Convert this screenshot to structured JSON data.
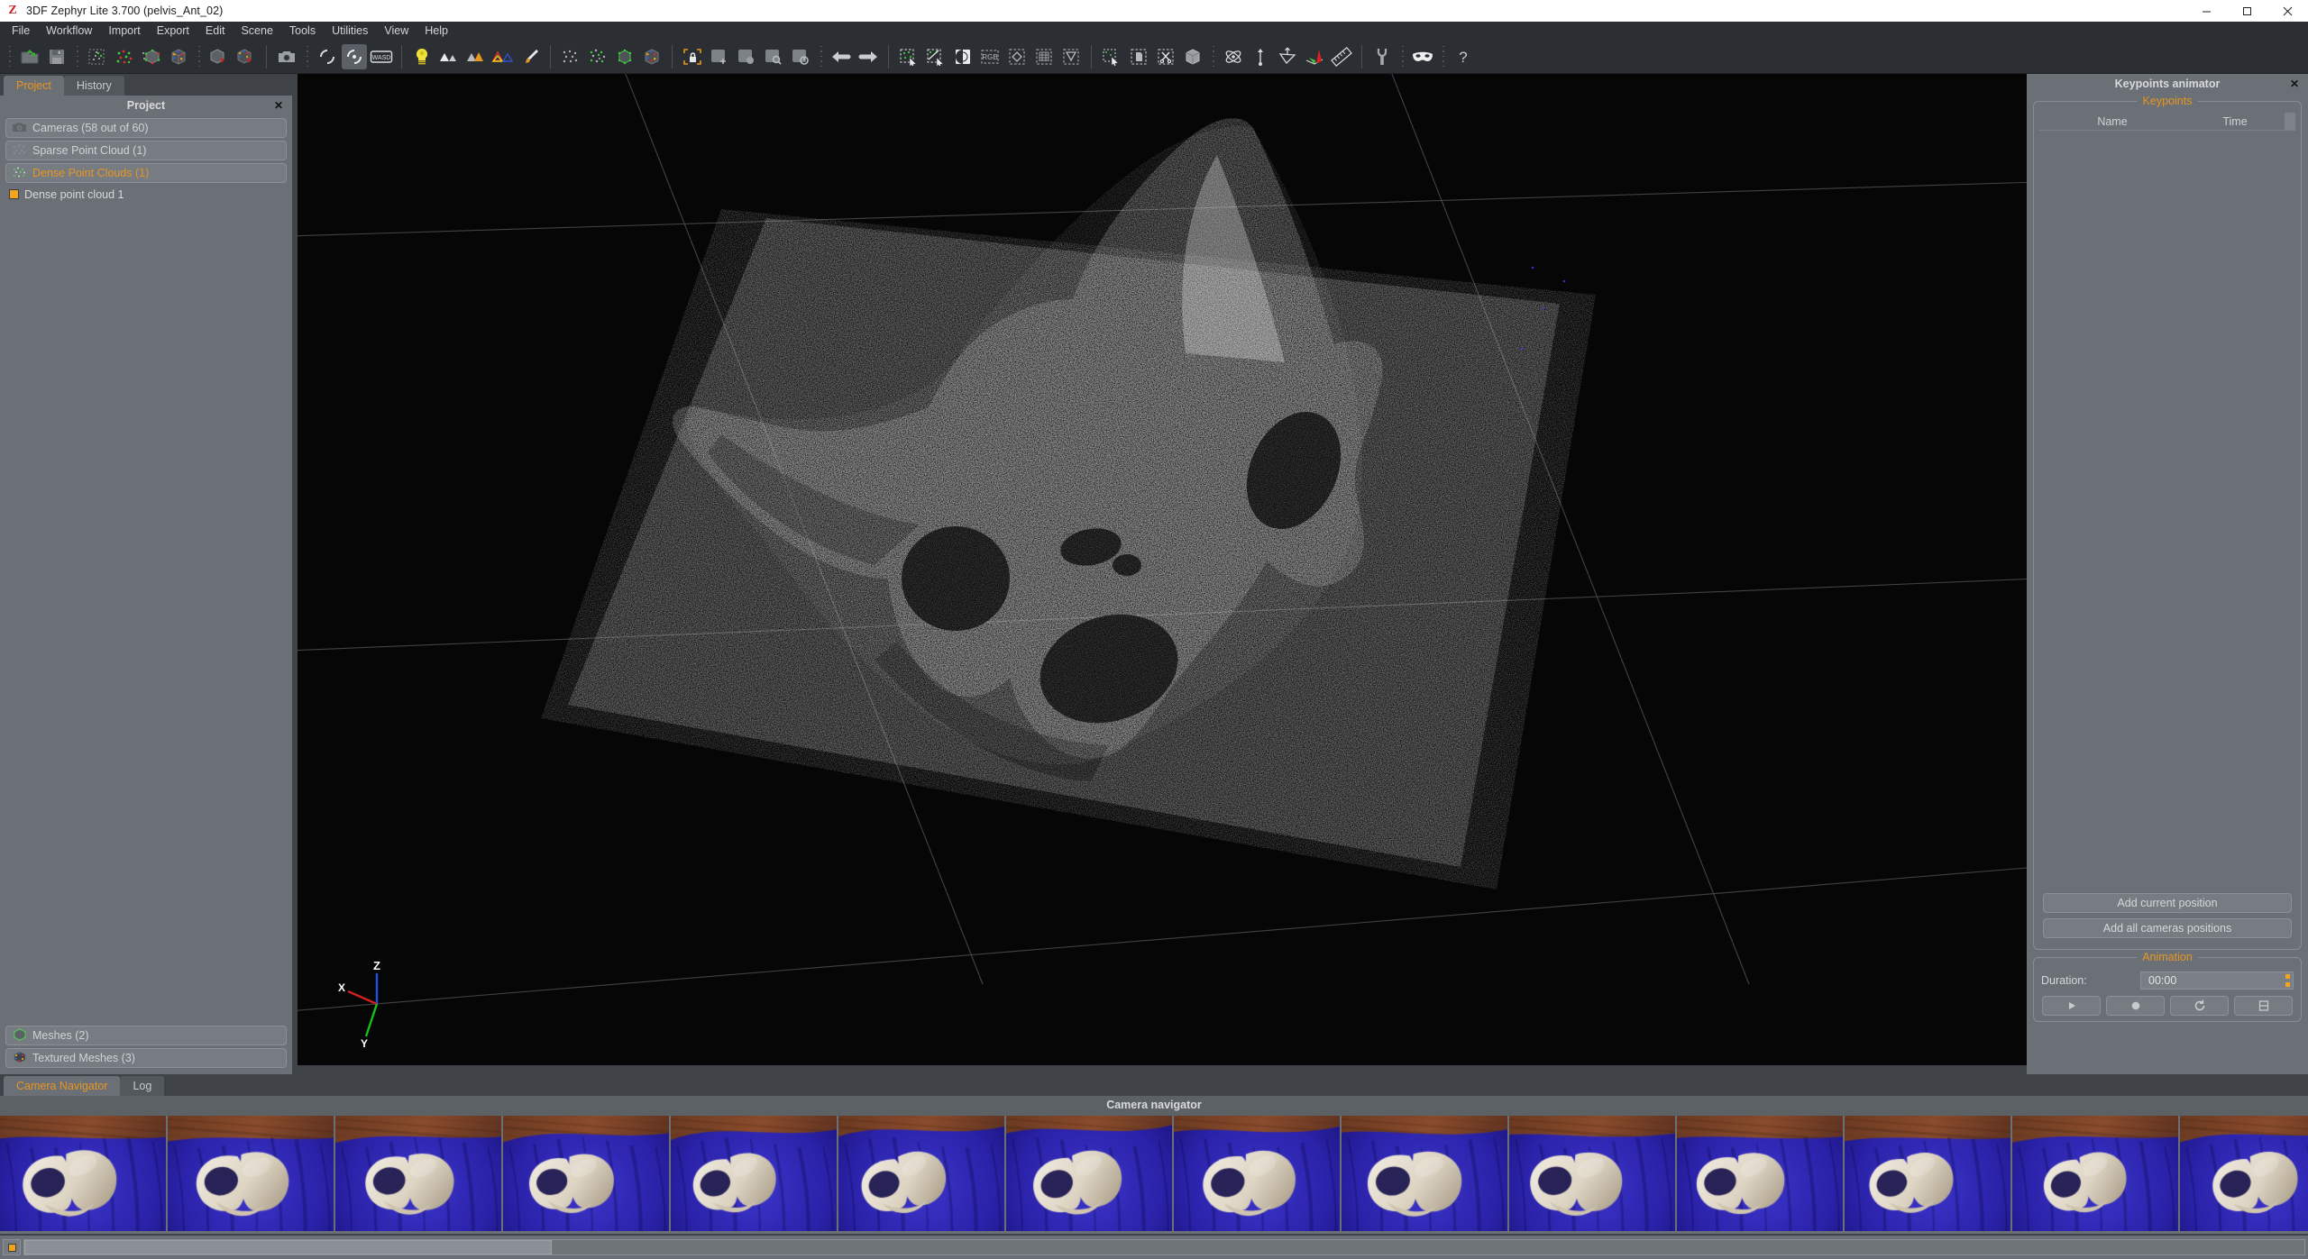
{
  "window": {
    "title": "3DF Zephyr Lite 3.700 (pelvis_Ant_02)",
    "logo_icon": "zephyr-logo-icon",
    "minimize_icon": "minimize-icon",
    "maximize_icon": "maximize-icon",
    "close_icon": "close-icon"
  },
  "menu": {
    "items": [
      {
        "label": "File"
      },
      {
        "label": "Workflow"
      },
      {
        "label": "Import"
      },
      {
        "label": "Export"
      },
      {
        "label": "Edit"
      },
      {
        "label": "Scene"
      },
      {
        "label": "Tools"
      },
      {
        "label": "Utilities"
      },
      {
        "label": "View"
      },
      {
        "label": "Help"
      }
    ]
  },
  "toolbar": {
    "groups": [
      {
        "buttons": [
          {
            "icon": "open-project-icon"
          },
          {
            "icon": "save-project-icon"
          }
        ]
      },
      {
        "buttons": [
          {
            "icon": "new-photos-icon"
          },
          {
            "icon": "sparse-cloud-generate-icon"
          },
          {
            "icon": "dense-cloud-generate-icon"
          },
          {
            "icon": "mesh-generate-icon"
          }
        ]
      },
      {
        "buttons": [
          {
            "icon": "mesh-extract-icon"
          },
          {
            "icon": "textured-mesh-extract-icon"
          }
        ]
      },
      {
        "buttons": [
          {
            "icon": "camera-snapshot-icon"
          }
        ]
      },
      {
        "buttons": [
          {
            "icon": "turntable-navigation-icon"
          },
          {
            "icon": "orbit-navigation-icon",
            "checked": true
          },
          {
            "icon": "wasd-navigation-icon"
          }
        ]
      },
      {
        "buttons": [
          {
            "icon": "lightbulb-icon"
          },
          {
            "icon": "cameras-white-icon"
          },
          {
            "icon": "cameras-orange-icon"
          },
          {
            "icon": "cameras-outline-icon"
          },
          {
            "icon": "paintbrush-icon"
          }
        ]
      },
      {
        "buttons": [
          {
            "icon": "sparse-points-visibility-icon"
          },
          {
            "icon": "dense-points-visibility-icon"
          },
          {
            "icon": "mesh-visibility-icon"
          },
          {
            "icon": "textured-mesh-visibility-icon"
          }
        ]
      },
      {
        "buttons": [
          {
            "icon": "lock-selection-icon"
          },
          {
            "icon": "move-gizmo-icon"
          },
          {
            "icon": "rotate-gizmo-icon"
          },
          {
            "icon": "scale-gizmo-icon"
          },
          {
            "icon": "reset-gizmo-icon"
          }
        ]
      },
      {
        "buttons": [
          {
            "icon": "undo-icon"
          },
          {
            "icon": "redo-icon"
          }
        ]
      },
      {
        "buttons": [
          {
            "icon": "select-points-icon"
          },
          {
            "icon": "deselect-points-icon"
          },
          {
            "icon": "invert-selection-icon"
          },
          {
            "icon": "rgb-filter-icon"
          },
          {
            "icon": "lasso-select-icon"
          },
          {
            "icon": "rectangle-select-icon"
          },
          {
            "icon": "polygon-select-icon"
          }
        ]
      },
      {
        "buttons": [
          {
            "icon": "filter-selection-icon"
          },
          {
            "icon": "copy-selection-icon"
          },
          {
            "icon": "cut-selection-icon"
          },
          {
            "icon": "bounding-box-icon"
          }
        ]
      },
      {
        "buttons": [
          {
            "icon": "orbit-axis-icon"
          },
          {
            "icon": "scale-distance-icon"
          },
          {
            "icon": "plane-constraint-icon"
          },
          {
            "icon": "control-points-icon"
          },
          {
            "icon": "measure-ruler-icon"
          }
        ]
      },
      {
        "buttons": [
          {
            "icon": "settings-wrench-icon"
          }
        ]
      },
      {
        "buttons": [
          {
            "icon": "masquerade-mask-icon"
          }
        ]
      },
      {
        "buttons": [
          {
            "icon": "help-question-icon"
          }
        ]
      }
    ]
  },
  "left_dock": {
    "tabs": [
      {
        "label": "Project",
        "active": true
      },
      {
        "label": "History",
        "active": false
      }
    ],
    "panel_title": "Project",
    "close_icon": "close-icon",
    "tree": [
      {
        "label": "Cameras (58 out of 60)",
        "icon": "camera-icon",
        "accent": false
      },
      {
        "label": "Sparse Point Cloud (1)",
        "icon": "sparse-cloud-icon",
        "accent": false
      },
      {
        "label": "Dense Point Clouds (1)",
        "icon": "dense-cloud-icon",
        "accent": true
      }
    ],
    "leaf": {
      "label": "Dense point cloud 1",
      "swatch_color": "#f2a51c"
    },
    "tree_bottom": [
      {
        "label": "Meshes (2)",
        "icon": "mesh-icon",
        "accent": false
      },
      {
        "label": "Textured Meshes (3)",
        "icon": "textured-mesh-icon",
        "accent": false
      }
    ]
  },
  "viewport": {
    "axes": {
      "x_label": "X",
      "y_label": "Y",
      "z_label": "Z",
      "x_color": "#d02020",
      "y_color": "#18c018",
      "z_color": "#2050e0"
    },
    "scene_description": "Dense point cloud of a human pelvis bone on a blue cloth ground plane"
  },
  "right_dock": {
    "title": "Keypoints animator",
    "close_icon": "close-icon",
    "keypoints_group": {
      "label": "Keypoints",
      "columns": [
        "Name",
        "Time"
      ],
      "rows": []
    },
    "buttons": [
      {
        "label": "Add current position"
      },
      {
        "label": "Add all cameras positions"
      }
    ],
    "animation_group": {
      "label": "Animation",
      "duration_label": "Duration:",
      "duration_value": "00:00",
      "controls": [
        {
          "icon": "play-icon"
        },
        {
          "icon": "record-icon"
        },
        {
          "icon": "loop-icon"
        },
        {
          "icon": "save-video-icon"
        }
      ]
    }
  },
  "bottom_dock": {
    "tabs": [
      {
        "label": "Camera Navigator",
        "active": true
      },
      {
        "label": "Log",
        "active": false
      }
    ],
    "title": "Camera navigator",
    "thumbnails": [
      {
        "name": "camera-thumbnail-1"
      },
      {
        "name": "camera-thumbnail-2"
      },
      {
        "name": "camera-thumbnail-3"
      },
      {
        "name": "camera-thumbnail-4"
      },
      {
        "name": "camera-thumbnail-5"
      },
      {
        "name": "camera-thumbnail-6"
      },
      {
        "name": "camera-thumbnail-7"
      },
      {
        "name": "camera-thumbnail-8"
      },
      {
        "name": "camera-thumbnail-9"
      },
      {
        "name": "camera-thumbnail-10"
      },
      {
        "name": "camera-thumbnail-11"
      },
      {
        "name": "camera-thumbnail-12"
      },
      {
        "name": "camera-thumbnail-13"
      },
      {
        "name": "camera-thumbnail-14"
      }
    ]
  },
  "colors": {
    "accent_orange": "#e8951f",
    "panel_bg": "#6b7076",
    "dock_bg": "#3f4347",
    "toolbar_bg": "#2b2f33",
    "viewport_bg": "#050505"
  }
}
